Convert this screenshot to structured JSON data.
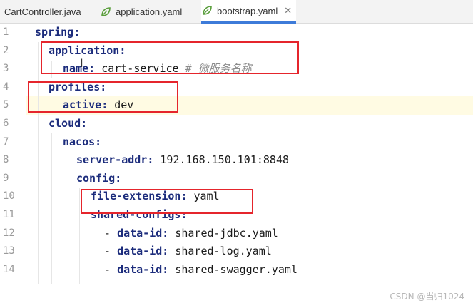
{
  "tabs": [
    {
      "label": "CartController.java",
      "icon": "java-file-icon",
      "active": false
    },
    {
      "label": "application.yaml",
      "icon": "spring-leaf-icon",
      "active": false
    },
    {
      "label": "bootstrap.yaml",
      "icon": "spring-leaf-icon",
      "active": true
    }
  ],
  "line_numbers": [
    "1",
    "2",
    "3",
    "4",
    "5",
    "6",
    "7",
    "8",
    "9",
    "10",
    "11",
    "12",
    "13",
    "14"
  ],
  "code": {
    "l1_key": "spring",
    "l1_colon": ":",
    "l2_key": "application",
    "l2_colon": ":",
    "l3_key": "name",
    "l3_colon": ": ",
    "l3_val": "cart-service",
    "l3_comment": " # 微服务名称",
    "l4_key": "profiles",
    "l4_colon": ":",
    "l5_key": "active",
    "l5_colon": ": ",
    "l5_val": "dev",
    "l6_key": "cloud",
    "l6_colon": ":",
    "l7_key": "nacos",
    "l7_colon": ":",
    "l8_key": "server-addr",
    "l8_colon": ": ",
    "l8_val": "192.168.150.101:8848",
    "l9_key": "config",
    "l9_colon": ":",
    "l10_key": "file-extension",
    "l10_colon": ": ",
    "l10_val": "yaml",
    "l11_key": "shared-configs",
    "l11_colon": ":",
    "l12_dash": "- ",
    "l12_key": "data-id",
    "l12_colon": ": ",
    "l12_val": "shared-jdbc.yaml",
    "l13_dash": "- ",
    "l13_key": "data-id",
    "l13_colon": ": ",
    "l13_val": "shared-log.yaml",
    "l14_dash": "- ",
    "l14_key": "data-id",
    "l14_colon": ": ",
    "l14_val": "shared-swagger.yaml"
  },
  "watermark": "CSDN @当归1024",
  "colors": {
    "highlight_box": "#e5252c",
    "key": "#1c2c7c",
    "active_tab": "#3d7bd9",
    "current_line": "#fffbe3"
  }
}
